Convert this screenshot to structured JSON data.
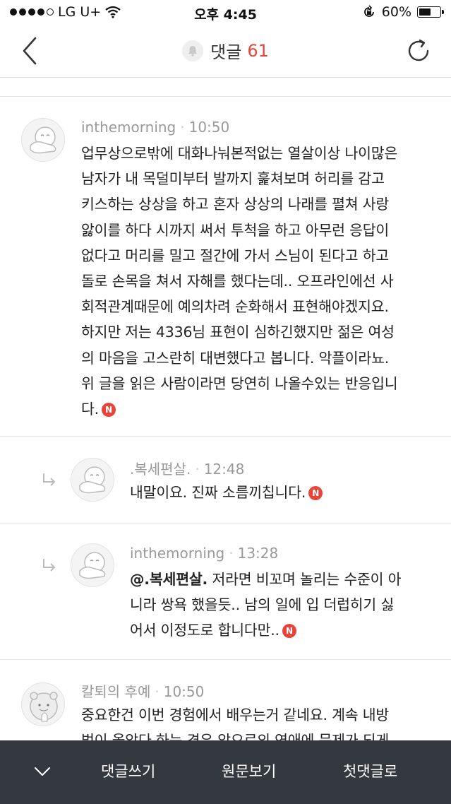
{
  "status_bar": {
    "carrier": "LG U+",
    "time": "오후 4:45",
    "battery_percent": "60%",
    "battery_level": 0.6
  },
  "header": {
    "title": "댓글",
    "count": "61",
    "back_icon": "chevron-left-icon",
    "refresh_icon": "refresh-icon",
    "bell_icon": "bell-icon"
  },
  "comments": [
    {
      "author": "inthemorning",
      "time": "10:50",
      "lines": [
        "업무상으로밖에 대화나눠본적없는 열살이상 나이많은",
        "남자가 내 목덜미부터 발까지 훑쳐보며 허리를 감고",
        "키스하는 상상을 하고 혼자 상상의 나래를 펼쳐 사랑",
        "앓이를 하다 시까지 써서 투척을 하고 아무런 응답이",
        "없다고 머리를 밀고 절간에 가서 스님이 된다고 하고",
        "돌로 손목을 쳐서 자해를 했다는데.. 오프라인에선 사",
        "회적관계때문에 예의차려 순화해서 표현해야겠지요.",
        "하지만 저는 4336님 표현이 심하긴했지만 젊은 여성",
        "의 마음을 고스란히 대변했다고 봅니다. 악플이라뇨.",
        "위 글을 읽은 사람이라면 당연히 나올수있는 반응입니"
      ],
      "last_line": "다."
    },
    {
      "author": ".복세편살.",
      "time": "12:48",
      "text": "내말이요. 진짜 소름끼칩니다."
    },
    {
      "author": "inthemorning",
      "time": "13:28",
      "mention": "@.복세편살.",
      "line1": " 저라면 비꼬며 놀리는 수준이 아",
      "line2": "니라 쌍욕 했을듯.. 남의 일에 입 더럽히기 싫",
      "line3": "어서 이정도로 합니다만.."
    },
    {
      "author": "칼퇴의 후예",
      "time": "10:50",
      "line1": "중요한건 이번 경험에서 배우는거 같네요. 계속 내방",
      "line2": "법이 올았다 하는 경우 앞으로의 연애에 문제가 되게"
    }
  ],
  "badge_letter": "N",
  "toolbar": {
    "write": "댓글쓰기",
    "original": "원문보기",
    "first": "첫댓글로"
  },
  "colors": {
    "accent": "#e8443a",
    "toolbar_bg": "#34383f",
    "meta_gray": "#999999"
  }
}
